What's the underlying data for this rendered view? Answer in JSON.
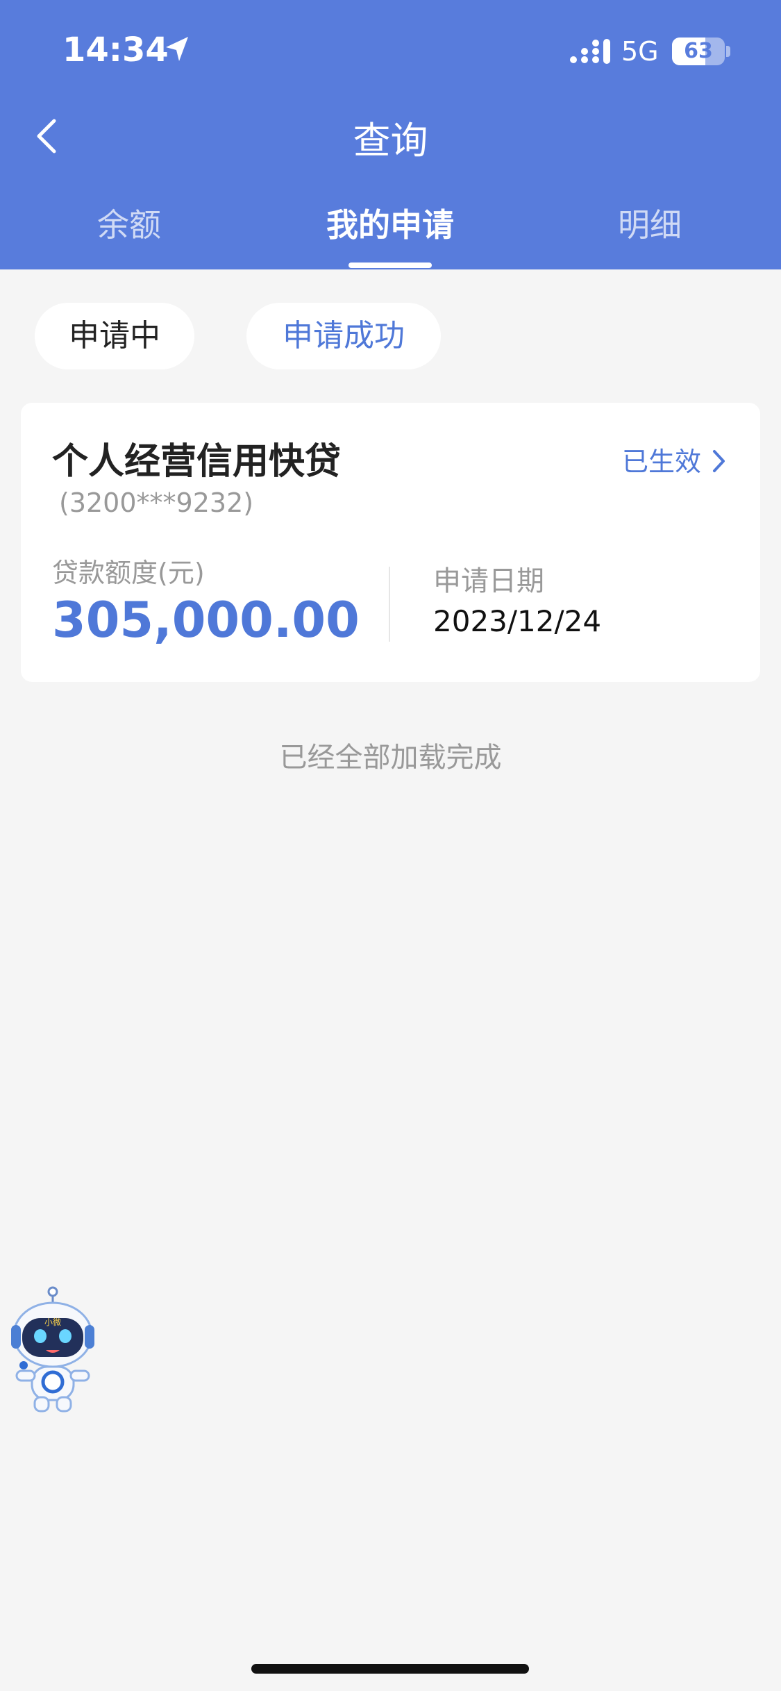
{
  "status_bar": {
    "time": "14:34",
    "network": "5G",
    "battery": "63",
    "battery_level": 0.63
  },
  "header": {
    "title": "查询",
    "back_icon": "chevron-left-icon",
    "tabs": [
      {
        "label": "余额",
        "active": false
      },
      {
        "label": "我的申请",
        "active": true
      },
      {
        "label": "明细",
        "active": false
      }
    ]
  },
  "filters": [
    {
      "label": "申请中",
      "active": false
    },
    {
      "label": "申请成功",
      "active": true
    }
  ],
  "application_card": {
    "product_name": "个人经营信用快贷",
    "account": "(3200***9232)",
    "status": "已生效",
    "amount_label": "贷款额度(元)",
    "amount": "305,000.00",
    "date_label": "申请日期",
    "date": "2023/12/24"
  },
  "footer_message": "已经全部加载完成",
  "assistant": {
    "icon": "robot-assistant-icon",
    "badge": "小微"
  },
  "colors": {
    "header_bg": "#587cdc",
    "accent": "#4f78d8",
    "page_bg": "#f5f5f5"
  }
}
